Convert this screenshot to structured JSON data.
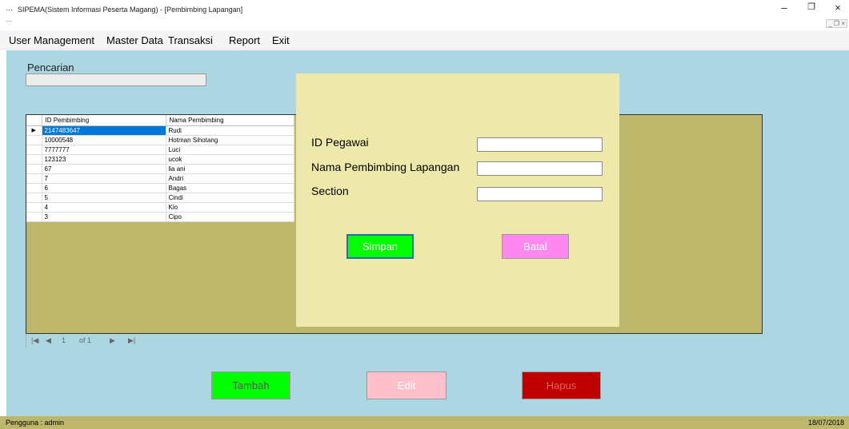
{
  "window": {
    "title": "SIPEMA(Sistem Informasi Peserta Magang) - [Pembimbing Lapangan]",
    "app_icon": "app-icon",
    "controls": [
      "–",
      "❐",
      "×"
    ]
  },
  "menu": [
    "User Management",
    "Master Data",
    "Transaksi",
    "Report",
    "Exit"
  ],
  "search": {
    "label": "Pencarian",
    "value": ""
  },
  "grid": {
    "columns": [
      "ID Pembimbing",
      "Nama Pembimbing"
    ],
    "rows": [
      [
        "2147483647",
        "Rudi"
      ],
      [
        "10000548",
        "Hotman Sihotang"
      ],
      [
        "7777777",
        "Luci"
      ],
      [
        "123123",
        "ucok"
      ],
      [
        "67",
        "lia ani"
      ],
      [
        "7",
        "Andri"
      ],
      [
        "6",
        "Bagas"
      ],
      [
        "5",
        "Cindi"
      ],
      [
        "4",
        "Kio"
      ],
      [
        "3",
        "Cipo"
      ]
    ],
    "selected_row": 0
  },
  "pager": {
    "first": "|◀",
    "prev": "◀",
    "page": "1",
    "of": "of 1",
    "next": "▶",
    "last": "▶|"
  },
  "buttons": {
    "add": "Tambah",
    "edit": "Edit",
    "delete": "Hapus"
  },
  "form": {
    "id_label": "ID Pegawai",
    "name_label": "Nama Pembimbing Lapangan",
    "section_label": "Section",
    "id_value": "",
    "name_value": "",
    "section_value": "",
    "save": "Simpan",
    "cancel": "Batal"
  },
  "status": {
    "user": "Pengguna : admin",
    "date": "18/07/2018"
  },
  "colors": {
    "client_bg": "#acd6e2",
    "grid_bg": "#bdb76b",
    "form_bg": "#eee8aa",
    "add_btn": "#00ff00",
    "edit_btn": "#ffc0cb",
    "delete_btn": "#c00000",
    "save_btn": "#00ff00",
    "cancel_btn": "#ff88f0",
    "selection": "#0078d7"
  }
}
